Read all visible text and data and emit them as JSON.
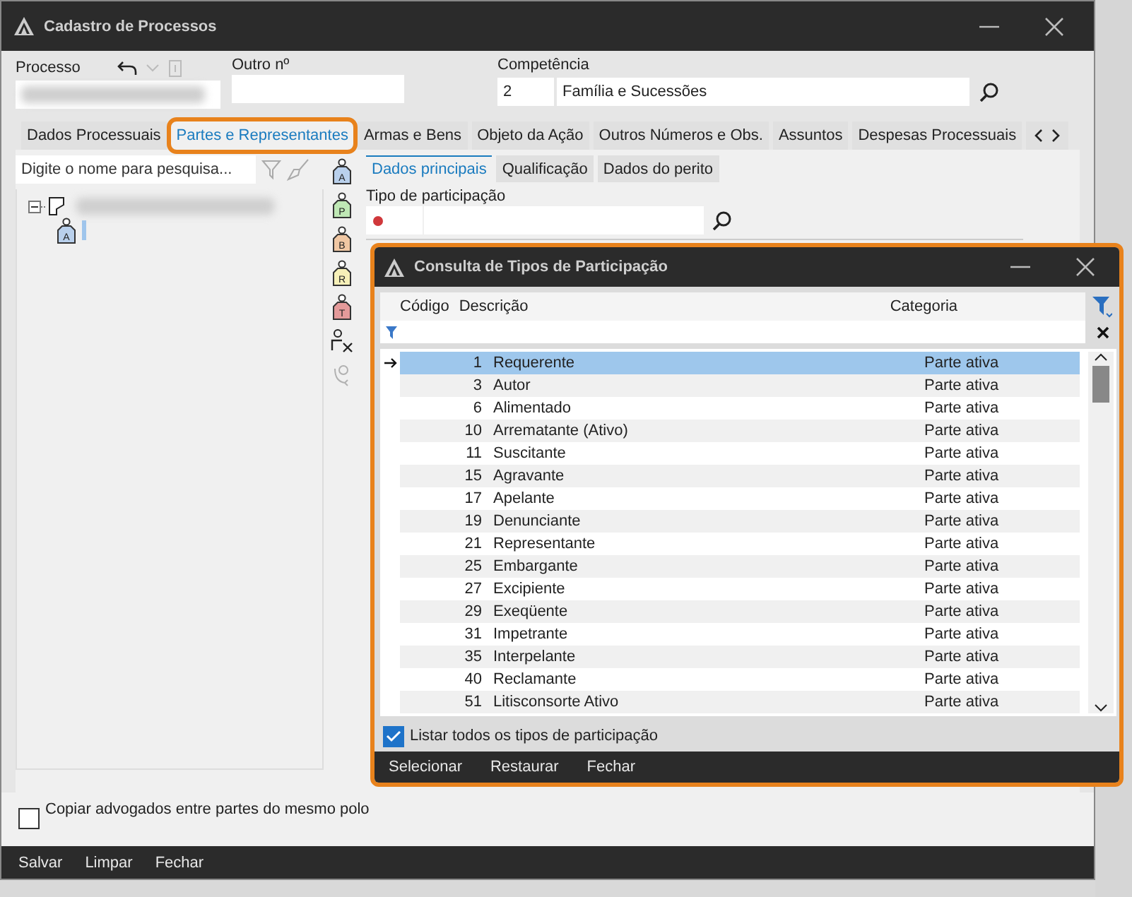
{
  "window": {
    "title": "Cadastro de Processos"
  },
  "header": {
    "processo_label": "Processo",
    "outro_label": "Outro nº",
    "competencia_label": "Competência",
    "competencia_code": "2",
    "competencia_name": "Família e Sucessões"
  },
  "tabs": [
    {
      "label": "Dados Processuais",
      "selected": false
    },
    {
      "label": "Partes e Representantes",
      "selected": true
    },
    {
      "label": "Armas e Bens",
      "selected": false
    },
    {
      "label": "Objeto da Ação",
      "selected": false
    },
    {
      "label": "Outros Números e Obs.",
      "selected": false
    },
    {
      "label": "Assuntos",
      "selected": false
    },
    {
      "label": "Despesas Processuais",
      "selected": false
    }
  ],
  "parties_search": {
    "placeholder": "Digite o nome para pesquisa..."
  },
  "tree": {
    "expanded": true,
    "children": [
      {
        "letter": "A"
      }
    ]
  },
  "party_buttons": [
    {
      "kind": "party",
      "letter": "A",
      "color": "#b9d0ec",
      "disabled": false
    },
    {
      "kind": "party",
      "letter": "P",
      "color": "#bfe8b5",
      "disabled": false
    },
    {
      "kind": "party",
      "letter": "B",
      "color": "#f0c7a3",
      "disabled": false
    },
    {
      "kind": "party",
      "letter": "R",
      "color": "#f6f0b8",
      "disabled": false
    },
    {
      "kind": "party",
      "letter": "T",
      "color": "#e49a9a",
      "disabled": false
    },
    {
      "kind": "remove",
      "disabled": false
    },
    {
      "kind": "swap",
      "disabled": true
    }
  ],
  "subtabs": [
    {
      "label": "Dados principais",
      "selected": true
    },
    {
      "label": "Qualificação",
      "selected": false
    },
    {
      "label": "Dados do perito",
      "selected": false
    }
  ],
  "tipo_participacao_label": "Tipo de participação",
  "copy_lawyers": {
    "label": "Copiar advogados entre partes do mesmo polo",
    "checked": false
  },
  "footer_buttons": [
    "Salvar",
    "Limpar",
    "Fechar"
  ],
  "dialog": {
    "title": "Consulta de Tipos de Participação",
    "columns": [
      "Código",
      "Descrição",
      "Categoria"
    ],
    "rows": [
      {
        "code": "1",
        "description": "Requerente",
        "category": "Parte ativa",
        "selected": true
      },
      {
        "code": "3",
        "description": "Autor",
        "category": "Parte ativa",
        "selected": false
      },
      {
        "code": "6",
        "description": "Alimentado",
        "category": "Parte ativa",
        "selected": false
      },
      {
        "code": "10",
        "description": "Arrematante (Ativo)",
        "category": "Parte ativa",
        "selected": false
      },
      {
        "code": "11",
        "description": "Suscitante",
        "category": "Parte ativa",
        "selected": false
      },
      {
        "code": "15",
        "description": "Agravante",
        "category": "Parte ativa",
        "selected": false
      },
      {
        "code": "17",
        "description": "Apelante",
        "category": "Parte ativa",
        "selected": false
      },
      {
        "code": "19",
        "description": "Denunciante",
        "category": "Parte ativa",
        "selected": false
      },
      {
        "code": "21",
        "description": "Representante",
        "category": "Parte ativa",
        "selected": false
      },
      {
        "code": "25",
        "description": "Embargante",
        "category": "Parte ativa",
        "selected": false
      },
      {
        "code": "27",
        "description": "Excipiente",
        "category": "Parte ativa",
        "selected": false
      },
      {
        "code": "29",
        "description": "Exeqüente",
        "category": "Parte ativa",
        "selected": false
      },
      {
        "code": "31",
        "description": "Impetrante",
        "category": "Parte ativa",
        "selected": false
      },
      {
        "code": "35",
        "description": "Interpelante",
        "category": "Parte ativa",
        "selected": false
      },
      {
        "code": "40",
        "description": "Reclamante",
        "category": "Parte ativa",
        "selected": false
      },
      {
        "code": "51",
        "description": "Litisconsorte Ativo",
        "category": "Parte ativa",
        "selected": false
      }
    ],
    "list_all": {
      "label": "Listar todos os tipos de participação",
      "checked": true
    },
    "buttons": [
      "Selecionar",
      "Restaurar",
      "Fechar"
    ]
  }
}
